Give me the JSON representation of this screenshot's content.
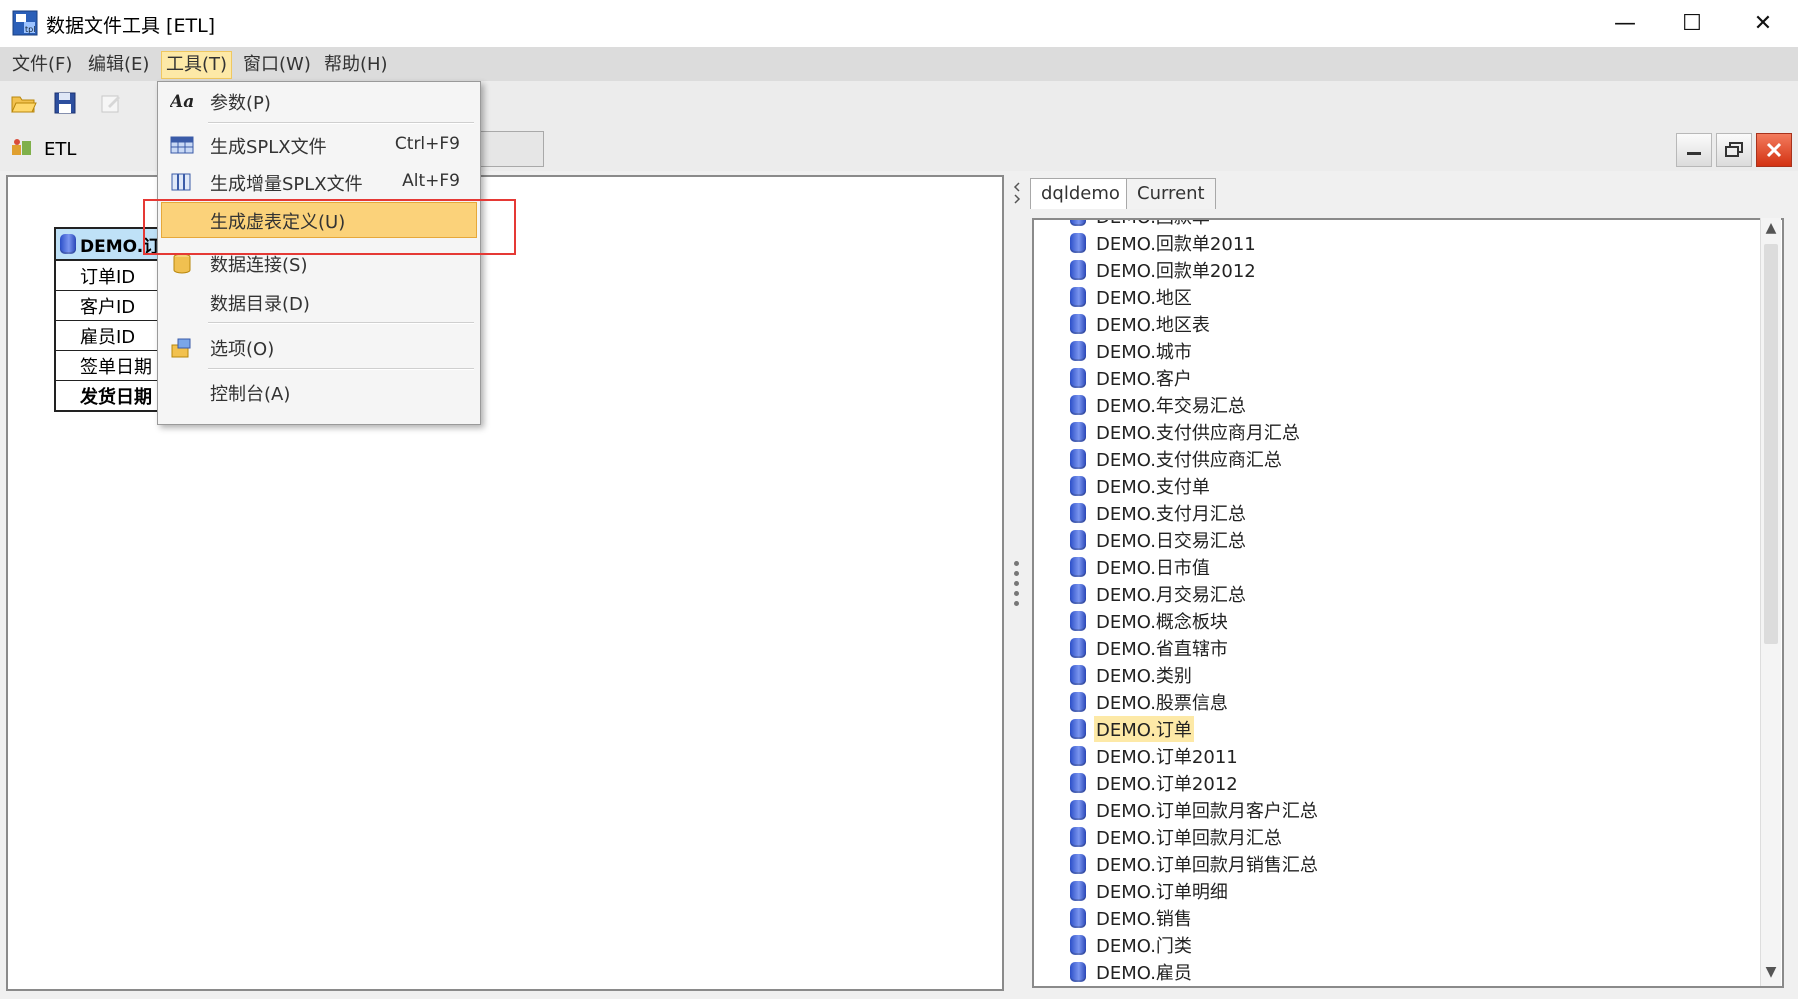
{
  "window": {
    "title": "数据文件工具 [ETL]",
    "minimize_glyph": "—",
    "maximize_glyph": "☐",
    "close_glyph": "✕"
  },
  "menubar": {
    "file": "文件(F)",
    "edit": "编辑(E)",
    "tools": "工具(T)",
    "window": "窗口(W)",
    "help": "帮助(H)"
  },
  "toolbar": {
    "icons": [
      "open-folder-icon",
      "save-icon",
      "edit-icon"
    ]
  },
  "etlbar": {
    "label": "ETL"
  },
  "tools_menu": {
    "items": [
      {
        "label": "参数(P)",
        "shortcut": "",
        "icon": "font-aa-icon"
      },
      {
        "label": "生成SPLX文件",
        "shortcut": "Ctrl+F9",
        "icon": "grid-table-icon"
      },
      {
        "label": "生成增量SPLX文件",
        "shortcut": "Alt+F9",
        "icon": "grid-columns-icon"
      },
      {
        "label": "生成虚表定义(U)",
        "shortcut": "",
        "icon": ""
      },
      {
        "label": "数据连接(S)",
        "shortcut": "",
        "icon": "database-icon"
      },
      {
        "label": "数据目录(D)",
        "shortcut": "",
        "icon": ""
      },
      {
        "label": "选项(O)",
        "shortcut": "",
        "icon": "options-icon"
      },
      {
        "label": "控制台(A)",
        "shortcut": "",
        "icon": ""
      }
    ]
  },
  "canvas_table": {
    "header": "DEMO.订单",
    "rows": [
      "订单ID",
      "客户ID",
      "雇员ID",
      "签单日期",
      "发货日期"
    ]
  },
  "right_panel": {
    "tabs": [
      "dqldemo",
      "Current"
    ],
    "tables": [
      "DEMO.回款单",
      "DEMO.回款单2011",
      "DEMO.回款单2012",
      "DEMO.地区",
      "DEMO.地区表",
      "DEMO.城市",
      "DEMO.客户",
      "DEMO.年交易汇总",
      "DEMO.支付供应商月汇总",
      "DEMO.支付供应商汇总",
      "DEMO.支付单",
      "DEMO.支付月汇总",
      "DEMO.日交易汇总",
      "DEMO.日市值",
      "DEMO.月交易汇总",
      "DEMO.概念板块",
      "DEMO.省直辖市",
      "DEMO.类别",
      "DEMO.股票信息",
      "DEMO.订单",
      "DEMO.订单2011",
      "DEMO.订单2012",
      "DEMO.订单回款月客户汇总",
      "DEMO.订单回款月汇总",
      "DEMO.订单回款月销售汇总",
      "DEMO.订单明细",
      "DEMO.销售",
      "DEMO.门类",
      "DEMO.雇员"
    ],
    "selected_table": "DEMO.订单"
  },
  "colors": {
    "menu_highlight": "#fbd27a",
    "selection": "#fde9a7",
    "annotation_box": "#e53935",
    "table_header": "#bfe1f7"
  }
}
